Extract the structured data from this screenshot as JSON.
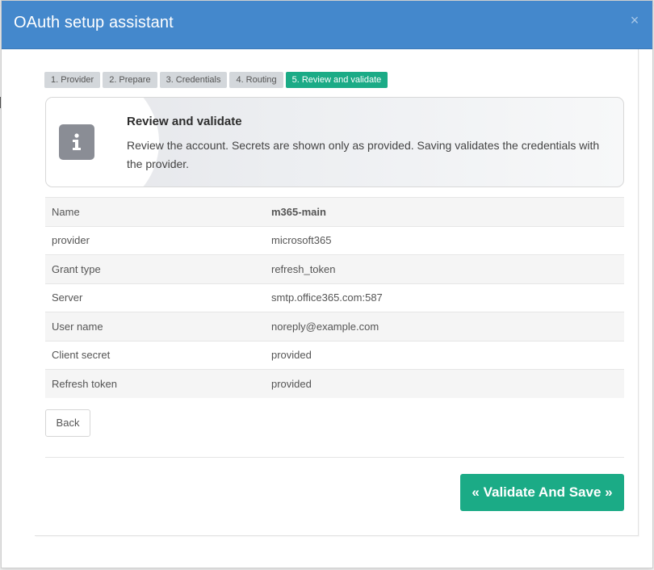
{
  "modal": {
    "title": "OAuth setup assistant",
    "close_label": "×"
  },
  "steps": [
    {
      "label": "1. Provider",
      "active": false
    },
    {
      "label": "2. Prepare",
      "active": false
    },
    {
      "label": "3. Credentials",
      "active": false
    },
    {
      "label": "4. Routing",
      "active": false
    },
    {
      "label": "5. Review and validate",
      "active": true
    }
  ],
  "info": {
    "icon": "info-icon",
    "title": "Review and validate",
    "text": "Review the account. Secrets are shown only as provided. Saving validates the credentials with the provider."
  },
  "review": {
    "rows": [
      {
        "label": "Name",
        "value": "m365-main"
      },
      {
        "label": "provider",
        "value": "microsoft365"
      },
      {
        "label": "Grant type",
        "value": "refresh_token"
      },
      {
        "label": "Server",
        "value": "smtp.office365.com:587"
      },
      {
        "label": "User name",
        "value": "noreply@example.com"
      },
      {
        "label": "Client secret",
        "value": "provided"
      },
      {
        "label": "Refresh token",
        "value": "provided"
      }
    ]
  },
  "actions": {
    "back_label": "Back",
    "save_label": "« Validate And Save »"
  },
  "colors": {
    "header": "#4488cc",
    "accent": "#1bab86",
    "step_inactive": "#d3d7db"
  }
}
